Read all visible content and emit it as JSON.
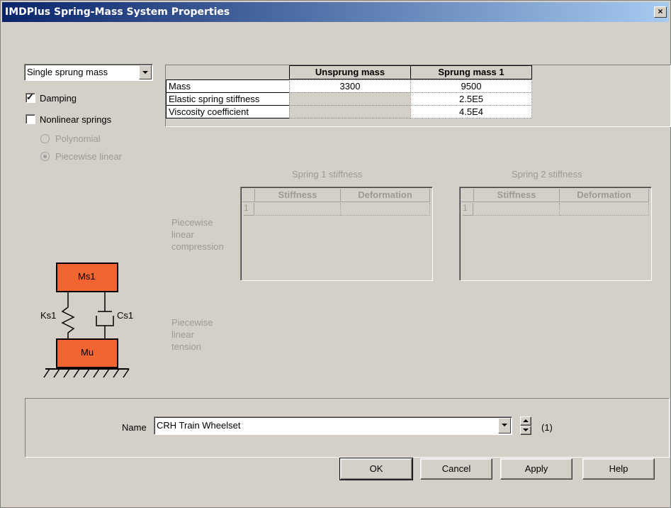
{
  "window": {
    "title": "IMDPlus Spring-Mass System Properties",
    "close_glyph": "×"
  },
  "model_select": {
    "value": "Single sprung mass"
  },
  "options": {
    "damping": {
      "label": "Damping",
      "checked": true
    },
    "nonlinear": {
      "label": "Nonlinear springs",
      "checked": false
    },
    "polynomial": {
      "label": "Polynomial",
      "selected": false
    },
    "piecewise": {
      "label": "Piecewise linear",
      "selected": true
    }
  },
  "props_table": {
    "headers": [
      "Unsprung mass",
      "Sprung mass 1"
    ],
    "rows": [
      {
        "label": "Mass",
        "unsprung": "3300",
        "sprung": "9500"
      },
      {
        "label": "Elastic spring stiffness",
        "unsprung": "",
        "sprung": "2.5E5"
      },
      {
        "label": "Viscosity coefficient",
        "unsprung": "",
        "sprung": "4.5E4"
      }
    ]
  },
  "spring_tables": {
    "spring1_title": "Spring 1 stiffness",
    "spring2_title": "Spring 2 stiffness",
    "col_stiffness": "Stiffness",
    "col_deformation": "Deformation",
    "row_index": "1",
    "compression_label": "Piecewise linear compression",
    "tension_label": "Piecewise linear tension"
  },
  "diagram": {
    "top_mass": "Ms1",
    "bottom_mass": "Mu",
    "spring": "Ks1",
    "damper": "Cs1",
    "mass_color": "#f26430"
  },
  "name_field": {
    "label": "Name",
    "value": "CRH Train Wheelset",
    "count": "(1)"
  },
  "buttons": {
    "ok": "OK",
    "cancel": "Cancel",
    "apply": "Apply",
    "help": "Help"
  }
}
